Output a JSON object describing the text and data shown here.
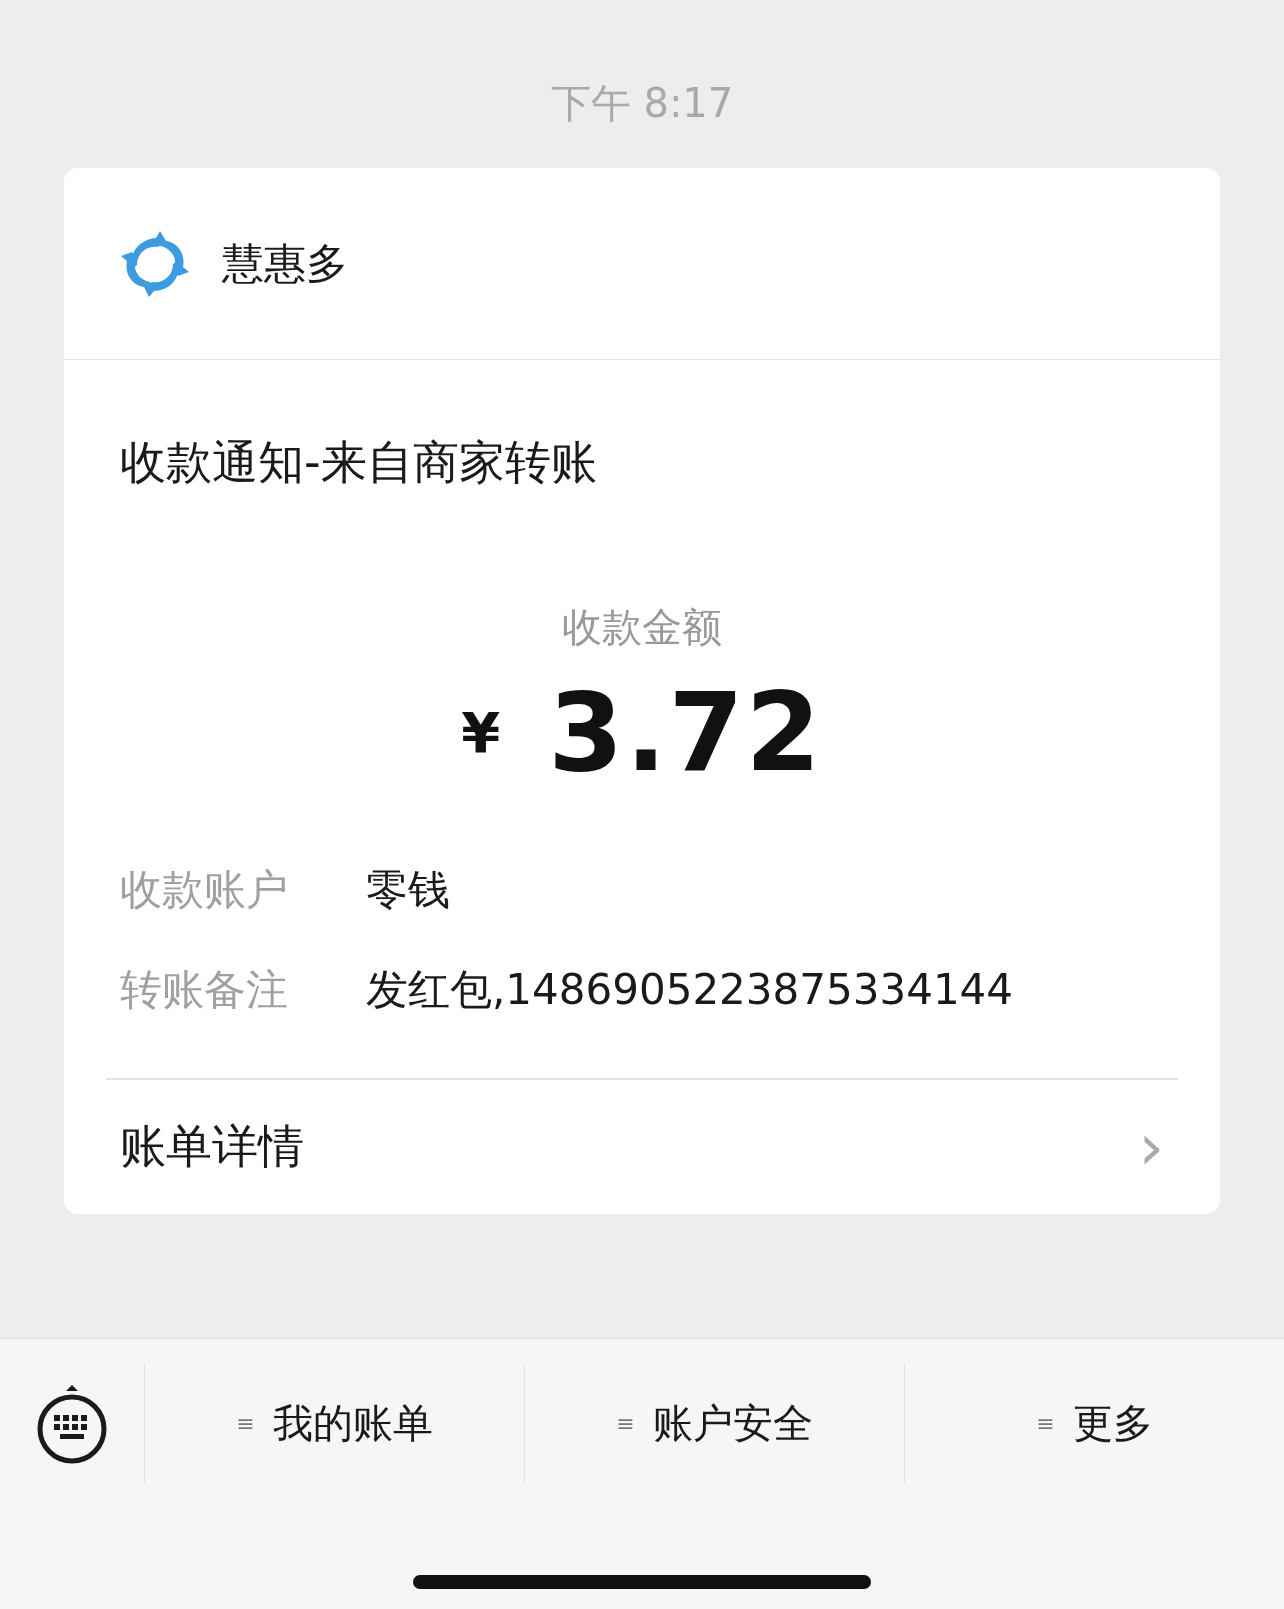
{
  "timestamp": "下午 8:17",
  "card": {
    "merchant": {
      "name": "慧惠多"
    },
    "title": "收款通知-来自商家转账",
    "amount_label": "收款金额",
    "currency": "¥",
    "amount": "3.72",
    "details": [
      {
        "label": "收款账户",
        "value": "零钱"
      },
      {
        "label": "转账备注",
        "value": "发红包,1486905223875334144"
      }
    ],
    "link": {
      "label": "账单详情",
      "chevron": "›"
    }
  },
  "menu_bar": {
    "items": [
      {
        "icon": "≡",
        "label": "我的账单"
      },
      {
        "icon": "≡",
        "label": "账户安全"
      },
      {
        "icon": "≡",
        "label": "更多"
      }
    ]
  }
}
